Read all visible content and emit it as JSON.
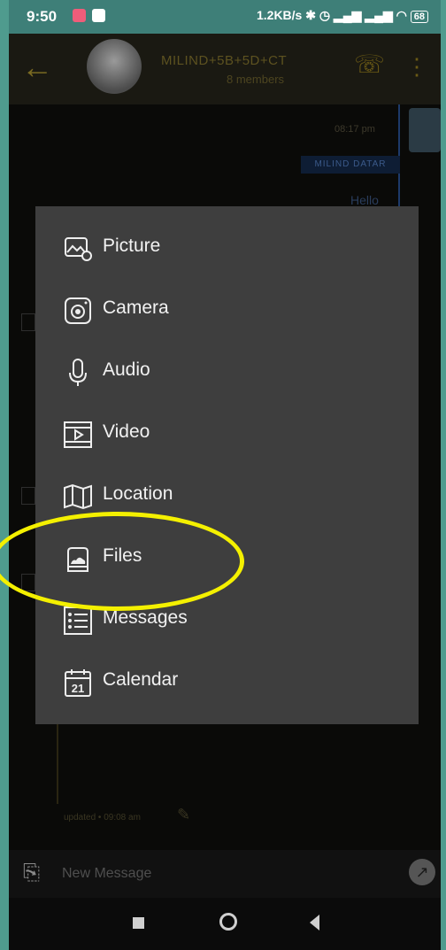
{
  "status_bar": {
    "time": "9:50",
    "right_text": "1.2KB/s",
    "battery": "68"
  },
  "app_bar": {
    "title": "MILIND+5B+5D+CT",
    "subtitle": "8 members"
  },
  "chat": {
    "bubble_time": "08:17 pm",
    "sender_tag": "MILIND DATAR",
    "message_text": "Hello",
    "footer_updated": "updated • 09:08 am"
  },
  "input": {
    "placeholder": "New Message"
  },
  "attach_menu": {
    "items": [
      {
        "label": "Picture",
        "icon": "picture-icon"
      },
      {
        "label": "Camera",
        "icon": "camera-icon"
      },
      {
        "label": "Audio",
        "icon": "microphone-icon"
      },
      {
        "label": "Video",
        "icon": "video-icon"
      },
      {
        "label": "Location",
        "icon": "map-icon"
      },
      {
        "label": "Files",
        "icon": "file-icon"
      },
      {
        "label": "Messages",
        "icon": "messages-icon"
      },
      {
        "label": "Calendar",
        "icon": "calendar-icon"
      }
    ]
  },
  "calendar_icon_number": "21",
  "colors": {
    "menu_bg": "#3e3e3e",
    "highlight": "#f4f000",
    "status_bar": "#3e7f78",
    "accent_dim": "#7a6a22"
  }
}
